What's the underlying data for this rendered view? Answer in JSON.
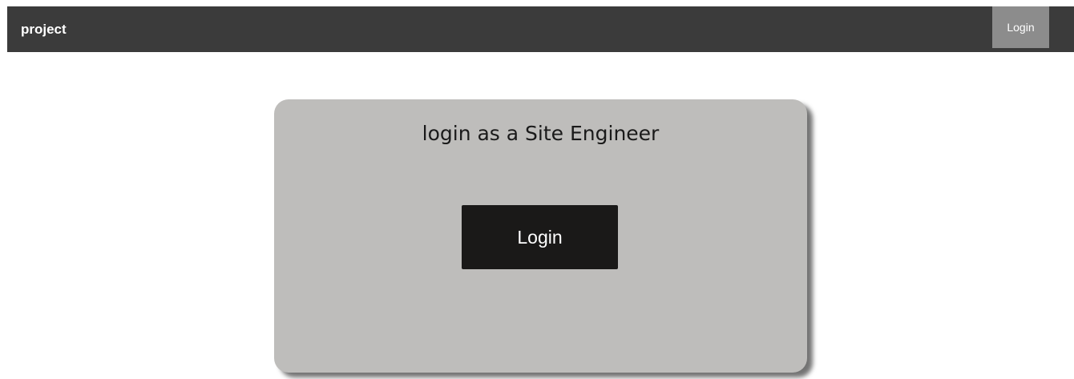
{
  "navbar": {
    "brand": "project",
    "login_label": "Login"
  },
  "card": {
    "title": "login as a Site Engineer",
    "login_button_label": "Login"
  },
  "colors": {
    "navbar_bg": "#3b3b3b",
    "nav_login_bg": "#8c8c8c",
    "card_bg": "#bebdbb",
    "button_bg": "#1a1918"
  }
}
